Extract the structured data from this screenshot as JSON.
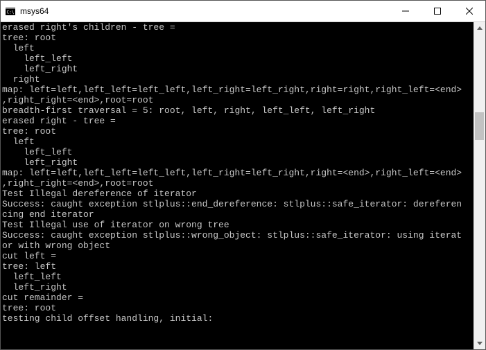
{
  "window": {
    "title": "msys64"
  },
  "terminal": {
    "lines": [
      "erased right's children - tree = ",
      "tree: root",
      "  left",
      "    left_left",
      "    left_right",
      "  right",
      "map: left=left,left_left=left_left,left_right=left_right,right=right,right_left=<end>",
      ",right_right=<end>,root=root",
      "breadth-first traversal = 5: root, left, right, left_left, left_right",
      "erased right - tree = ",
      "tree: root",
      "  left",
      "    left_left",
      "    left_right",
      "map: left=left,left_left=left_left,left_right=left_right,right=<end>,right_left=<end>",
      ",right_right=<end>,root=root",
      "Test Illegal dereference of iterator",
      "Success: caught exception stlplus::end_dereference: stlplus::safe_iterator: dereferen",
      "cing end iterator",
      "Test Illegal use of iterator on wrong tree",
      "Success: caught exception stlplus::wrong_object: stlplus::safe_iterator: using iterat",
      "or with wrong object",
      "cut left = ",
      "tree: left",
      "  left_left",
      "  left_right",
      "cut remainder = ",
      "tree: root",
      "testing child offset handling, initial:"
    ]
  }
}
